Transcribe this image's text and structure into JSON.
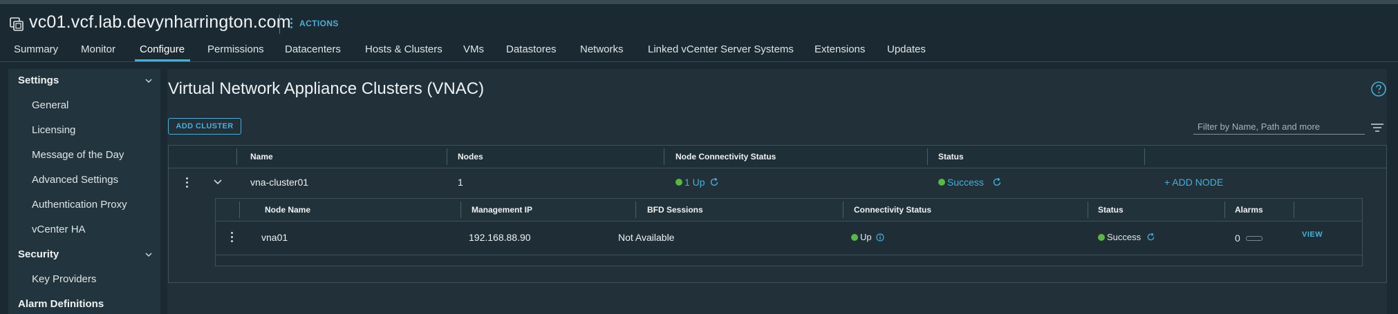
{
  "header": {
    "title": "vc01.vcf.lab.devynharrington.com",
    "actions_label": "ACTIONS"
  },
  "tabs": [
    {
      "label": "Summary"
    },
    {
      "label": "Monitor"
    },
    {
      "label": "Configure",
      "active": true
    },
    {
      "label": "Permissions"
    },
    {
      "label": "Datacenters"
    },
    {
      "label": "Hosts & Clusters"
    },
    {
      "label": "VMs"
    },
    {
      "label": "Datastores"
    },
    {
      "label": "Networks"
    },
    {
      "label": "Linked vCenter Server Systems"
    },
    {
      "label": "Extensions"
    },
    {
      "label": "Updates"
    }
  ],
  "sidebar": {
    "settings_label": "Settings",
    "settings_items": [
      {
        "label": "General"
      },
      {
        "label": "Licensing"
      },
      {
        "label": "Message of the Day"
      },
      {
        "label": "Advanced Settings"
      },
      {
        "label": "Authentication Proxy"
      },
      {
        "label": "vCenter HA"
      }
    ],
    "security_label": "Security",
    "security_items": [
      {
        "label": "Key Providers"
      }
    ],
    "alarm_label": "Alarm Definitions"
  },
  "main": {
    "title": "Virtual Network Appliance Clusters (VNAC)",
    "add_cluster_label": "ADD CLUSTER",
    "filter_placeholder": "Filter by Name, Path and more",
    "columns": {
      "name": "Name",
      "nodes": "Nodes",
      "node_connectivity": "Node Connectivity Status",
      "status": "Status"
    },
    "cluster_row": {
      "name": "vna-cluster01",
      "nodes": "1",
      "node_connectivity": "1 Up",
      "status": "Success",
      "add_node": "+ ADD NODE"
    },
    "node_columns": {
      "node_name": "Node Name",
      "management_ip": "Management IP",
      "bfd_sessions": "BFD Sessions",
      "connectivity": "Connectivity Status",
      "status": "Status",
      "alarms": "Alarms"
    },
    "node_row": {
      "node_name": "vna01",
      "management_ip": "192.168.88.90",
      "bfd_sessions": "Not Available",
      "connectivity": "Up",
      "status": "Success",
      "alarms": "0",
      "view": "VIEW"
    }
  },
  "colors": {
    "accent": "#49afd9",
    "success": "#5bb83d",
    "background": "#1b2a32"
  }
}
